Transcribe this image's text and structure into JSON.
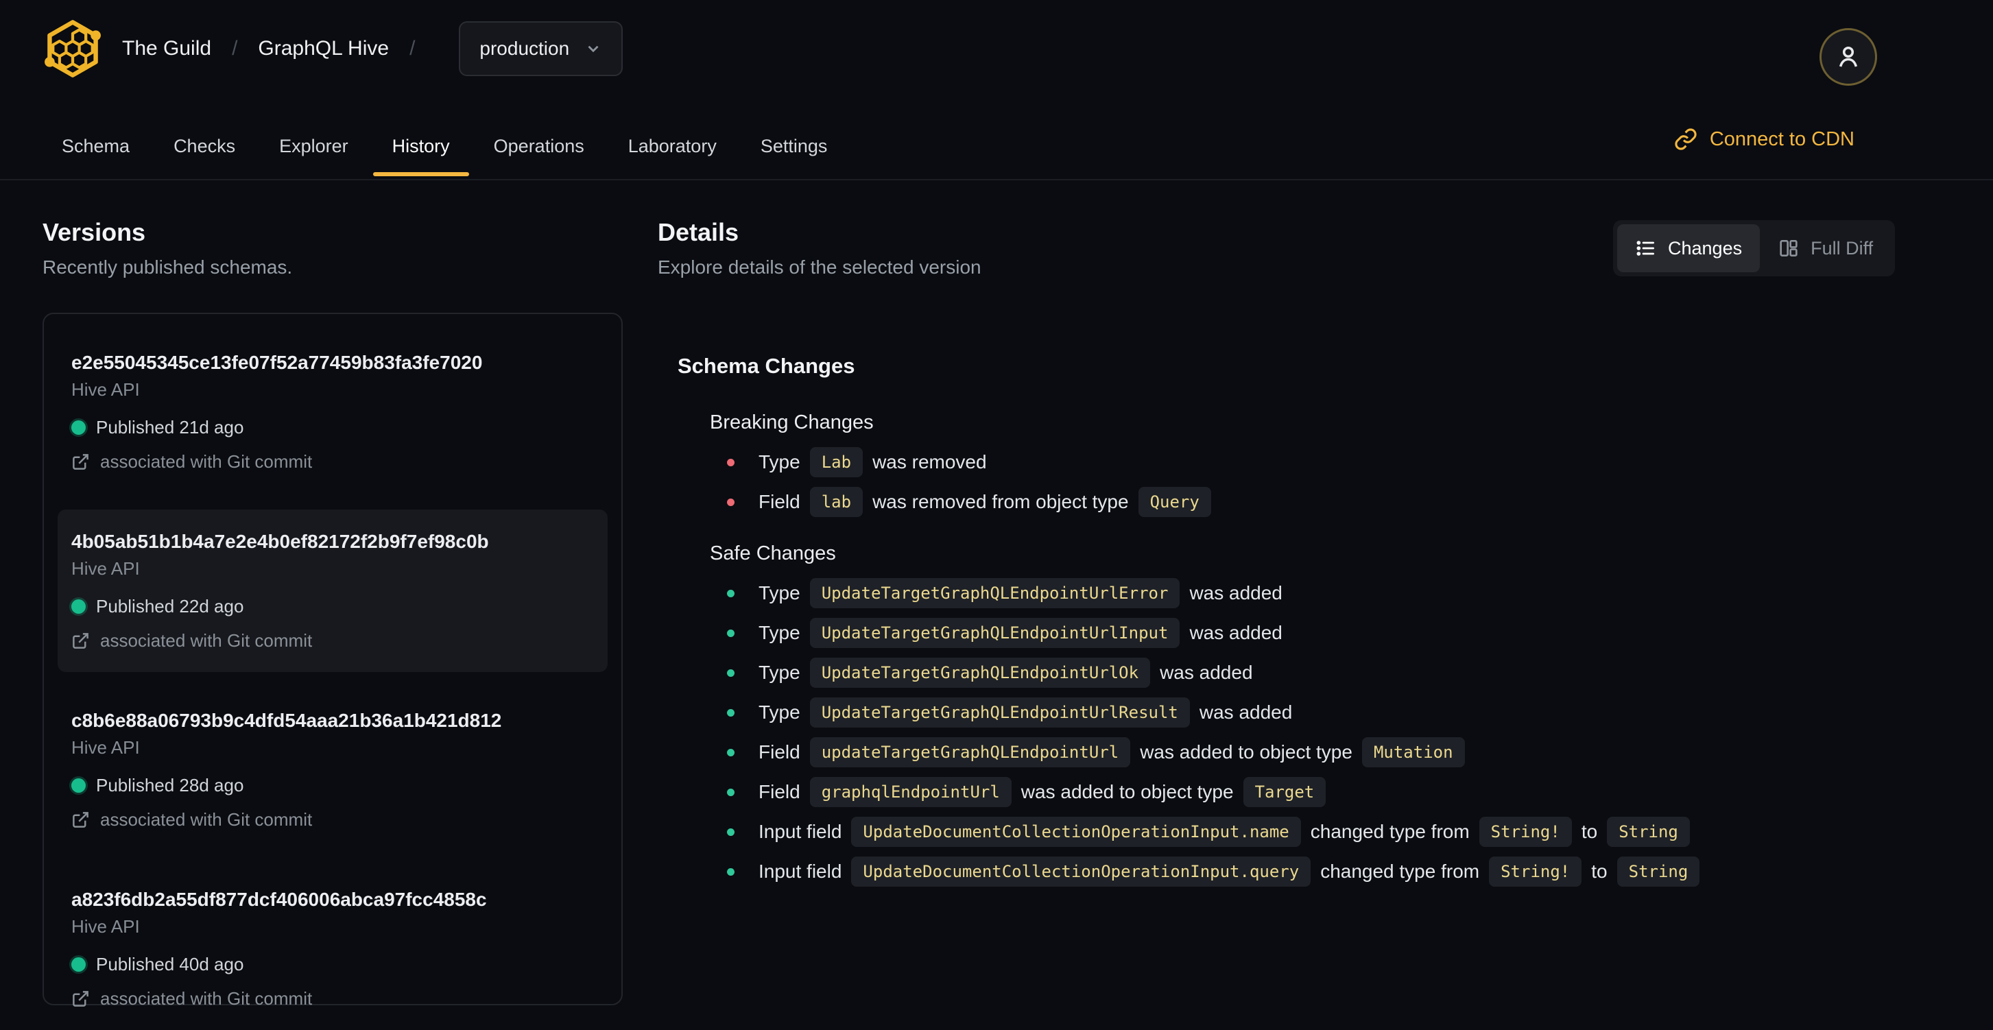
{
  "colors": {
    "accent": "#f4b740",
    "published_green": "#17bd8d",
    "safe_bullet": "#30c99a",
    "breaking_bullet": "#ee6a74",
    "code_text": "#ecd98f",
    "background": "#0a0c11"
  },
  "icons": [
    "hive-logo-icon",
    "chevron-down-icon",
    "user-icon",
    "link-icon",
    "list-icon",
    "diff-columns-icon",
    "external-link-icon"
  ],
  "header": {
    "breadcrumb": {
      "org": "The Guild",
      "separator": "/",
      "project": "GraphQL Hive",
      "target": "production"
    },
    "tabs": [
      {
        "label": "Schema",
        "active": false
      },
      {
        "label": "Checks",
        "active": false
      },
      {
        "label": "Explorer",
        "active": false
      },
      {
        "label": "History",
        "active": true
      },
      {
        "label": "Operations",
        "active": false
      },
      {
        "label": "Laboratory",
        "active": false
      },
      {
        "label": "Settings",
        "active": false
      }
    ],
    "cdn_link": "Connect to CDN"
  },
  "versions_panel": {
    "title": "Versions",
    "subtitle": "Recently published schemas.",
    "items": [
      {
        "hash": "e2e55045345ce13fe07f52a77459b83fa3fe7020",
        "service": "Hive API",
        "published": "Published 21d ago",
        "git": "associated with Git commit",
        "selected": false
      },
      {
        "hash": "4b05ab51b1b4a7e2e4b0ef82172f2b9f7ef98c0b",
        "service": "Hive API",
        "published": "Published 22d ago",
        "git": "associated with Git commit",
        "selected": true
      },
      {
        "hash": "c8b6e88a06793b9c4dfd54aaa21b36a1b421d812",
        "service": "Hive API",
        "published": "Published 28d ago",
        "git": "associated with Git commit",
        "selected": false
      },
      {
        "hash": "a823f6db2a55df877dcf406006abca97fcc4858c",
        "service": "Hive API",
        "published": "Published 40d ago",
        "git": "associated with Git commit",
        "selected": false
      }
    ]
  },
  "details_panel": {
    "title": "Details",
    "subtitle": "Explore details of the selected version",
    "view_toggle": {
      "changes": "Changes",
      "full_diff": "Full Diff",
      "active": "Changes"
    },
    "schema_changes": {
      "title": "Schema Changes",
      "breaking": {
        "title": "Breaking Changes",
        "rows": [
          [
            {
              "t": "text",
              "v": "Type"
            },
            {
              "t": "code",
              "v": "Lab"
            },
            {
              "t": "text",
              "v": "was removed"
            }
          ],
          [
            {
              "t": "text",
              "v": "Field"
            },
            {
              "t": "code",
              "v": "lab"
            },
            {
              "t": "text",
              "v": "was removed from object type"
            },
            {
              "t": "code",
              "v": "Query"
            }
          ]
        ]
      },
      "safe": {
        "title": "Safe Changes",
        "rows": [
          [
            {
              "t": "text",
              "v": "Type"
            },
            {
              "t": "code",
              "v": "UpdateTargetGraphQLEndpointUrlError"
            },
            {
              "t": "text",
              "v": "was added"
            }
          ],
          [
            {
              "t": "text",
              "v": "Type"
            },
            {
              "t": "code",
              "v": "UpdateTargetGraphQLEndpointUrlInput"
            },
            {
              "t": "text",
              "v": "was added"
            }
          ],
          [
            {
              "t": "text",
              "v": "Type"
            },
            {
              "t": "code",
              "v": "UpdateTargetGraphQLEndpointUrlOk"
            },
            {
              "t": "text",
              "v": "was added"
            }
          ],
          [
            {
              "t": "text",
              "v": "Type"
            },
            {
              "t": "code",
              "v": "UpdateTargetGraphQLEndpointUrlResult"
            },
            {
              "t": "text",
              "v": "was added"
            }
          ],
          [
            {
              "t": "text",
              "v": "Field"
            },
            {
              "t": "code",
              "v": "updateTargetGraphQLEndpointUrl"
            },
            {
              "t": "text",
              "v": "was added to object type"
            },
            {
              "t": "code",
              "v": "Mutation"
            }
          ],
          [
            {
              "t": "text",
              "v": "Field"
            },
            {
              "t": "code",
              "v": "graphqlEndpointUrl"
            },
            {
              "t": "text",
              "v": "was added to object type"
            },
            {
              "t": "code",
              "v": "Target"
            }
          ],
          [
            {
              "t": "text",
              "v": "Input field"
            },
            {
              "t": "code",
              "v": "UpdateDocumentCollectionOperationInput.name"
            },
            {
              "t": "text",
              "v": "changed type from"
            },
            {
              "t": "code",
              "v": "String!"
            },
            {
              "t": "text",
              "v": "to"
            },
            {
              "t": "code",
              "v": "String"
            }
          ],
          [
            {
              "t": "text",
              "v": "Input field"
            },
            {
              "t": "code",
              "v": "UpdateDocumentCollectionOperationInput.query"
            },
            {
              "t": "text",
              "v": "changed type from"
            },
            {
              "t": "code",
              "v": "String!"
            },
            {
              "t": "text",
              "v": "to"
            },
            {
              "t": "code",
              "v": "String"
            }
          ]
        ]
      }
    }
  }
}
